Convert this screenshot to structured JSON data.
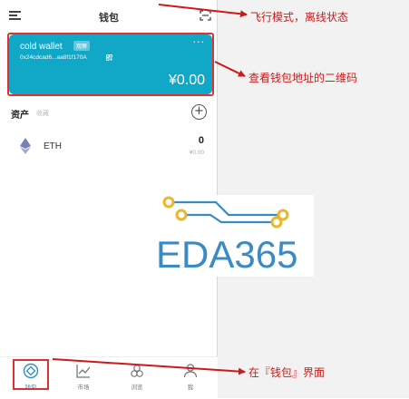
{
  "header": {
    "title": "钱包"
  },
  "wallet": {
    "name": "cold wallet",
    "badge": "观察",
    "address": "0x24cdcad6...aa8f1f170A",
    "balance": "¥0.00",
    "more": "···"
  },
  "assets": {
    "label": "资产",
    "collect": "收藏",
    "add": "+"
  },
  "tokens": [
    {
      "symbol": "ETH",
      "amount": "0",
      "value": "¥0.00"
    }
  ],
  "tabs": [
    {
      "label": "钱包",
      "icon": "wallet-icon"
    },
    {
      "label": "市场",
      "icon": "chart-icon"
    },
    {
      "label": "浏览",
      "icon": "browse-icon"
    },
    {
      "label": "我",
      "icon": "profile-icon"
    }
  ],
  "annotations": {
    "offline": "飞行模式，离线状态",
    "qr": "查看钱包地址的二维码",
    "wallet_page": "在『钱包』界面"
  },
  "watermark": "EDA365",
  "colors": {
    "card": "#11a8c8",
    "accent": "#2b8fc9",
    "annotation": "#d01818",
    "logo": "#3a8bc4",
    "logo_node": "#e8b82a"
  }
}
